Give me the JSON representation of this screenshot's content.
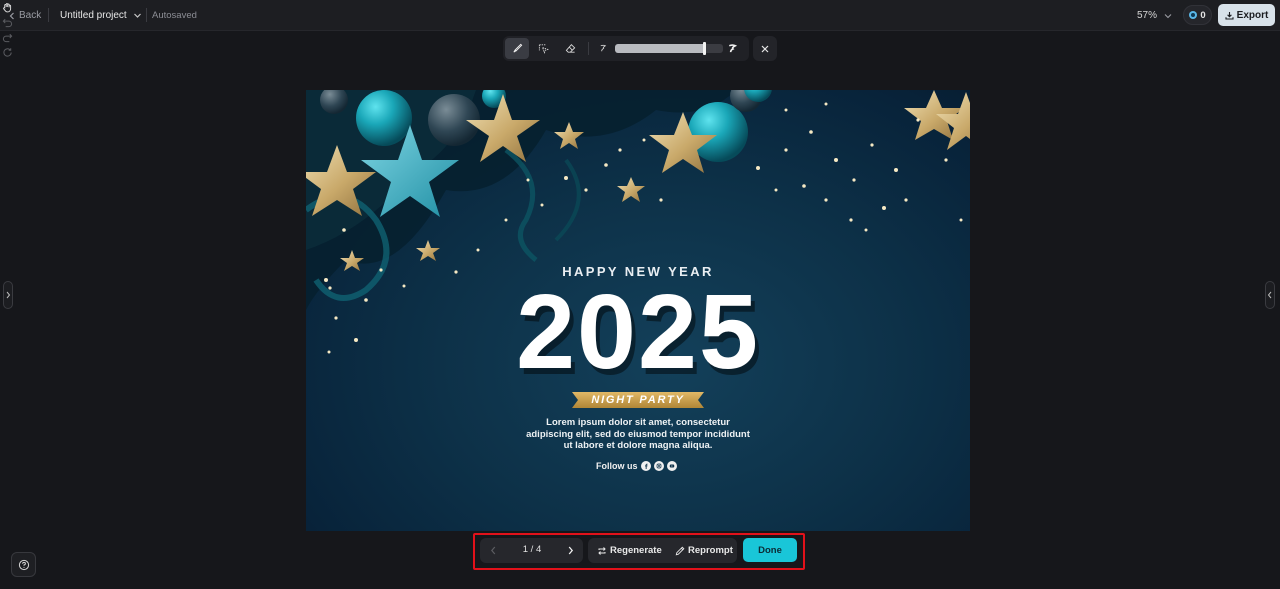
{
  "header": {
    "back_label": "Back",
    "project_name": "Untitled project",
    "save_status": "Autosaved",
    "zoom_level": "57%",
    "credits": "0",
    "export_label": "Export",
    "icons": [
      "hand-icon",
      "undo-icon",
      "redo-icon",
      "refresh-icon"
    ]
  },
  "brush_toolbar": {
    "tools": [
      "brush-icon",
      "select-brush-icon",
      "eraser-icon"
    ],
    "brush_size_fraction": 0.82
  },
  "canvas": {
    "headline": "HAPPY NEW YEAR",
    "year": "2025",
    "ribbon": "NIGHT PARTY",
    "body_lines": [
      "Lorem ipsum dolor sit amet, consectetur",
      "adipiscing elit, sed do eiusmod tempor incididunt",
      "ut labore et dolore magna aliqua."
    ],
    "follow": "Follow us",
    "colors": {
      "background": "#0d3148",
      "ribbon": "#c9a04a",
      "star": "#d7c08d",
      "ornament": "#1aa7b8"
    }
  },
  "variant_bar": {
    "page_indicator": "1 / 4",
    "regenerate_label": "Regenerate",
    "reprompt_label": "Reprompt",
    "done_label": "Done",
    "accent": "#19c6d8"
  }
}
